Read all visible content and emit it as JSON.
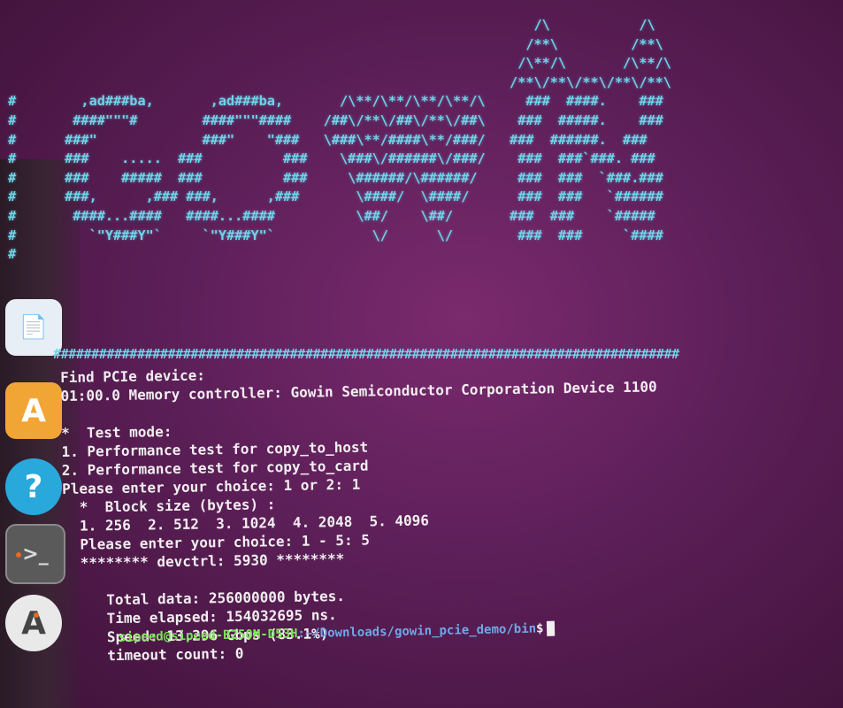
{
  "dock": {
    "files_icon": "files-icon",
    "store_icon": "software-store-icon",
    "help_icon": "help-icon",
    "terminal_icon": "terminal-icon",
    "updater_icon": "software-updater-icon",
    "active_indicator_color": "#e46a28"
  },
  "terminal": {
    "banner_art": "                                                                  /\\           /\\\n                                                                 /**\\         /**\\\n                                                                /\\**/\\       /\\**/\\\n                                                               /**\\/**\\/**\\/**\\/**\\\n #        ,ad###ba,       ,ad###ba,       /\\**/\\**/\\**/\\**/\\     ###  ####.    ###\n #       ####\"\"\"#        ####\"\"\"####    /##\\/**\\/##\\/**\\/##\\    ###  #####.    ###\n #      ###\"             ###\"    \"###   \\###\\**/####\\**/###/   ###  ######.  ###\n #      ###    .....  ###          ###    \\###\\/######\\/###/    ###  ###`###. ###\n #      ###    #####  ###          ###     \\######/\\######/     ###  ###  `###.###\n #      ###,      ,### ###,      ,###       \\####/  \\####/      ###  ###   `######\n #       ####...####   ####...####          \\##/    \\##/       ###  ###    `#####\n #         `\"Y###Y\"`     `\"Y###Y\"`            \\/      \\/        ###  ###     `####\n #",
    "hash_row": "##################################################################################",
    "lines": [
      "Find PCIe device:",
      "01:00.0 Memory controller: Gowin Semiconductor Corporation Device 1100",
      "",
      "*  Test mode:",
      "1. Performance test for copy_to_host",
      "2. Performance test for copy_to_card",
      "Please enter your choice: 1 or 2: 1",
      "  *  Block size (bytes) :",
      "  1. 256  2. 512  3. 1024  4. 2048  5. 4096",
      "  Please enter your choice: 1 - 5: 5",
      "  ******** devctrl: 5930 ********",
      "",
      "     Total data: 256000000 bytes.",
      "     Time elapsed: 154032695 ns.",
      "     Speed: 13.296 Gbps (83.1%)",
      "     timeout count: 0"
    ],
    "prompt_user": "sipeed@sipeed-B250M-D53H",
    "prompt_path": ":~/Downloads/gowin_pcie_demo/bin",
    "prompt_dollar": "$"
  }
}
